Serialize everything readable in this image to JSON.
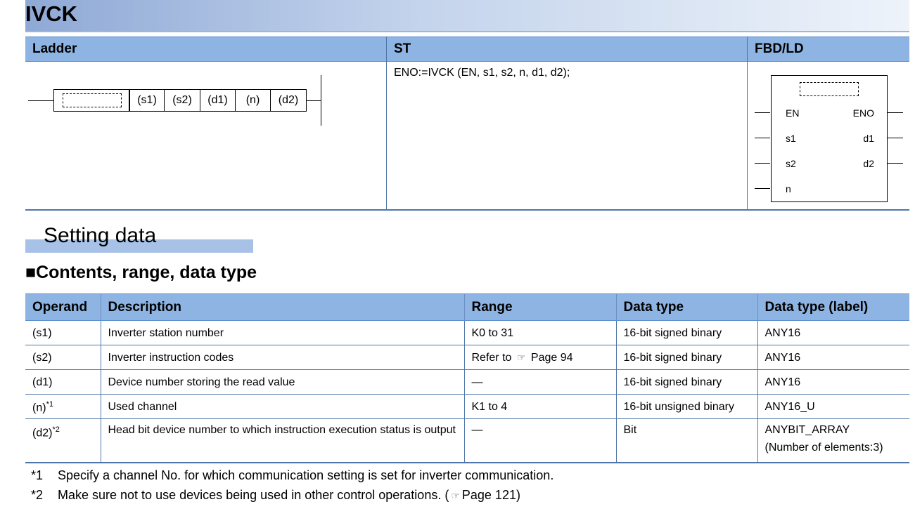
{
  "title": "IVCK",
  "syntax": {
    "headers": [
      "Ladder",
      "ST",
      "FBD/LD"
    ],
    "ladder_operands": [
      "(s1)",
      "(s2)",
      "(d1)",
      "(n)",
      "(d2)"
    ],
    "st_code": "ENO:=IVCK (EN, s1, s2, n, d1, d2);",
    "fbd": {
      "left_pins": [
        "EN",
        "s1",
        "s2",
        "n"
      ],
      "right_pins": [
        "ENO",
        "d1",
        "d2"
      ]
    }
  },
  "section_title": "Setting data",
  "subsection_title": "■Contents, range, data type",
  "table": {
    "headers": [
      "Operand",
      "Description",
      "Range",
      "Data type",
      "Data type (label)"
    ],
    "rows": [
      {
        "operand": "(s1)",
        "sup": "",
        "description": "Inverter station number",
        "range": "K0 to 31",
        "range_ref": "",
        "data_type": "16-bit signed binary",
        "label": "ANY16",
        "label2": ""
      },
      {
        "operand": "(s2)",
        "sup": "",
        "description": "Inverter instruction codes",
        "range": "Refer to",
        "range_ref": "Page 94",
        "data_type": "16-bit signed binary",
        "label": "ANY16",
        "label2": ""
      },
      {
        "operand": "(d1)",
        "sup": "",
        "description": "Device number storing the read value",
        "range": "—",
        "range_ref": "",
        "data_type": "16-bit signed binary",
        "label": "ANY16",
        "label2": ""
      },
      {
        "operand": "(n)",
        "sup": "*1",
        "description": "Used channel",
        "range": "K1 to 4",
        "range_ref": "",
        "data_type": "16-bit unsigned binary",
        "label": "ANY16_U",
        "label2": ""
      },
      {
        "operand": "(d2)",
        "sup": "*2",
        "description": "Head bit device number to which instruction execution status is output",
        "range": "—",
        "range_ref": "",
        "data_type": "Bit",
        "label": "ANYBIT_ARRAY",
        "label2": "(Number of elements:3)"
      }
    ]
  },
  "notes": [
    {
      "mark": "*1",
      "text": "Specify a channel No. for which communication setting is set for inverter communication."
    },
    {
      "mark": "*2",
      "text": "Make sure not to use devices being used in other control operations. (",
      "ref": "Page 121",
      "tail": ")"
    }
  ],
  "icons": {
    "page_ref": "pointing-hand-icon"
  }
}
